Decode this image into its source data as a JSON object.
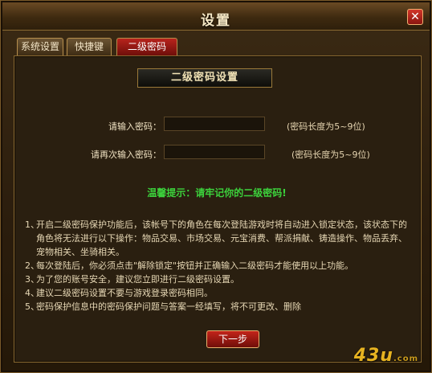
{
  "window": {
    "title": "设置"
  },
  "tabs": [
    {
      "label": "系统设置"
    },
    {
      "label": "快捷键"
    },
    {
      "label": "二级密码"
    }
  ],
  "panel": {
    "heading": "二级密码设置",
    "password": {
      "label": "请输入密码：",
      "value": "",
      "hint": "(密码长度为5~9位)"
    },
    "confirm": {
      "label": "请再次输入密码：",
      "value": "",
      "hint": "(密码长度为5~9位)"
    },
    "reminder": "温馨提示：请牢记你的二级密码!",
    "notes": [
      {
        "num": "1、",
        "text": "开启二级密码保护功能后，该帐号下的角色在每次登陆游戏时将自动进入锁定状态，该状态下的角色将无法进行以下操作：物品交易、市场交易、元宝消费、帮派捐献、铸造操作、物品丢弃、宠物相关、坐骑相关。"
      },
      {
        "num": "2、",
        "text": "每次登陆后，你必须点击\"解除锁定\"按钮并正确输入二级密码才能使用以上功能。"
      },
      {
        "num": "3、",
        "text": "为了您的账号安全，建议您立即进行二级密码设置。"
      },
      {
        "num": "4、",
        "text": "建议二级密码设置不要与游戏登录密码相同。"
      },
      {
        "num": "5、",
        "text": "密码保护信息中的密码保护问题与答案一经填写，将不可更改、删除"
      }
    ],
    "next_label": "下一步"
  },
  "watermark": {
    "text": "43u",
    "suffix": ".com"
  },
  "colors": {
    "accent_red": "#b8241c",
    "reminder_green": "#3cd23c",
    "gold": "#e7b321"
  }
}
